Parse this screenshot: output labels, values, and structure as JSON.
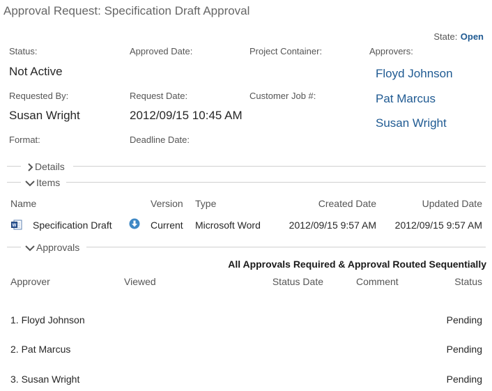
{
  "title": "Approval Request: Specification Draft Approval",
  "state": {
    "label": "State:",
    "value": "Open"
  },
  "fields": {
    "status_label": "Status:",
    "status_value": "Not Active",
    "approved_date_label": "Approved Date:",
    "project_container_label": "Project Container:",
    "approvers_label": "Approvers:",
    "requested_by_label": "Requested By:",
    "requested_by_value": "Susan Wright",
    "request_date_label": "Request Date:",
    "request_date_value": "2012/09/15 10:45 AM",
    "customer_job_label": "Customer Job #:",
    "format_label": "Format:",
    "deadline_date_label": "Deadline Date:"
  },
  "approvers": [
    "Floyd Johnson",
    "Pat Marcus",
    "Susan Wright"
  ],
  "sections": {
    "details": "Details",
    "items": "Items",
    "approvals": "Approvals"
  },
  "items_table": {
    "headers": {
      "name": "Name",
      "version": "Version",
      "type": "Type",
      "created": "Created Date",
      "updated": "Updated Date"
    },
    "rows": [
      {
        "name": "Specification Draft",
        "version": "Current",
        "type": "Microsoft Word",
        "created": "2012/09/15 9:57 AM",
        "updated": "2012/09/15 9:57 AM",
        "icon": "word-document-icon"
      }
    ]
  },
  "approvals_table": {
    "requirement": "All Approvals Required & Approval Routed Sequentially",
    "headers": {
      "approver": "Approver",
      "viewed": "Viewed",
      "status_date": "Status Date",
      "comment": "Comment",
      "status": "Status"
    },
    "rows": [
      {
        "approver": "1. Floyd Johnson",
        "status": "Pending"
      },
      {
        "approver": "2. Pat Marcus",
        "status": "Pending"
      },
      {
        "approver": "3. Susan Wright",
        "status": "Pending"
      }
    ]
  },
  "colors": {
    "link": "#1f5a92",
    "divider": "#d0d0d0"
  }
}
